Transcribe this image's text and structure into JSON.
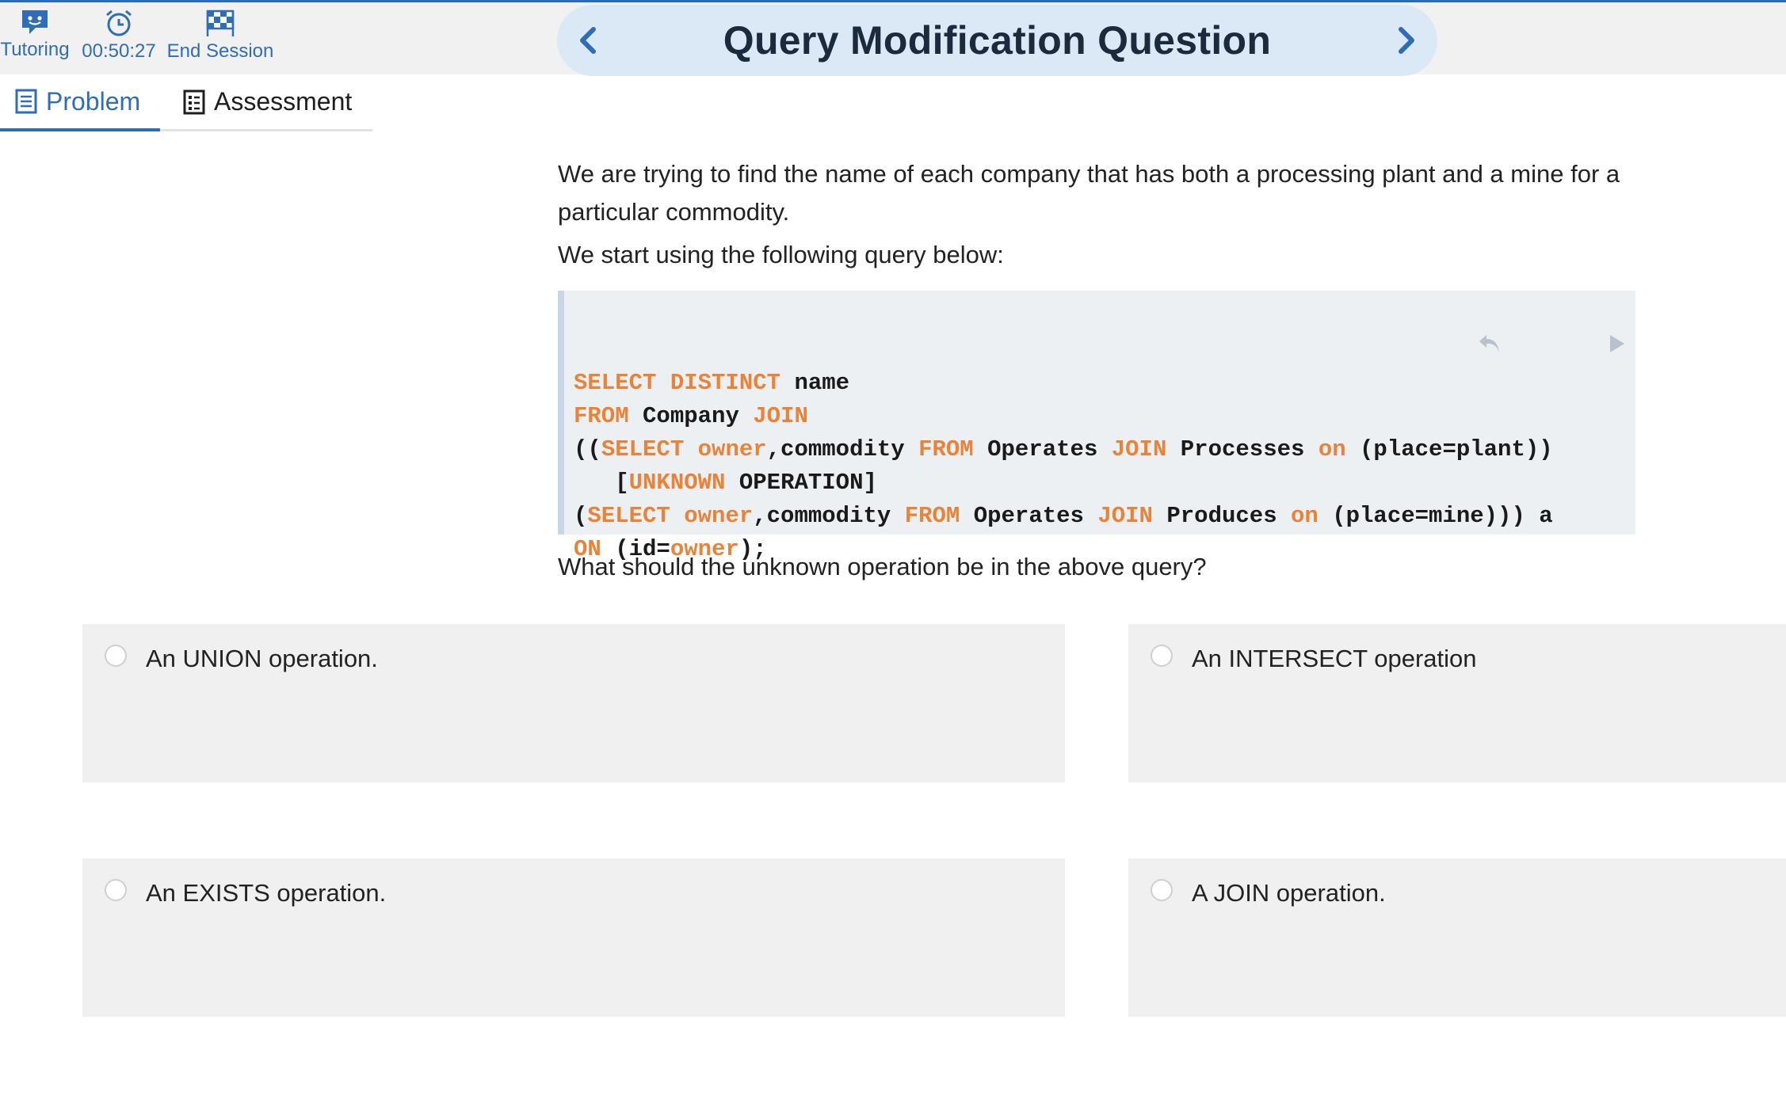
{
  "toolbar": {
    "tutoring_label": "Tutoring",
    "timer": "00:50:27",
    "end_session_label": "End Session",
    "accent_color": "#2f6db5"
  },
  "header": {
    "title": "Query Modification Question",
    "prev_icon": "chevron-left-icon",
    "next_icon": "chevron-right-icon"
  },
  "tabs": [
    {
      "label": "Problem",
      "icon": "document-icon",
      "active": true
    },
    {
      "label": "Assessment",
      "icon": "list-icon",
      "active": false
    }
  ],
  "problem": {
    "intro": "We are trying to find the name of each company that has both a processing plant and a mine for a particular commodity.",
    "lead": "We start using the following query below:",
    "question": "What should the unknown operation be in the above query?"
  },
  "code": {
    "keyword_color": "#e8833a",
    "lines": [
      [
        {
          "t": "SELECT DISTINCT",
          "k": true
        },
        {
          "t": " name",
          "k": false
        }
      ],
      [
        {
          "t": "FROM",
          "k": true
        },
        {
          "t": " Company ",
          "k": false
        },
        {
          "t": "JOIN",
          "k": true
        }
      ],
      [
        {
          "t": "((",
          "k": false
        },
        {
          "t": "SELECT owner",
          "k": true
        },
        {
          "t": ",commodity ",
          "k": false
        },
        {
          "t": "FROM",
          "k": true
        },
        {
          "t": " Operates ",
          "k": false
        },
        {
          "t": "JOIN",
          "k": true
        },
        {
          "t": " Processes ",
          "k": false
        },
        {
          "t": "on",
          "k": true
        },
        {
          "t": " (place=plant))",
          "k": false
        }
      ],
      [
        {
          "t": "   [",
          "k": false
        },
        {
          "t": "UNKNOWN",
          "k": true
        },
        {
          "t": " OPERATION]",
          "k": false
        }
      ],
      [
        {
          "t": "(",
          "k": false
        },
        {
          "t": "SELECT owner",
          "k": true
        },
        {
          "t": ",commodity ",
          "k": false
        },
        {
          "t": "FROM",
          "k": true
        },
        {
          "t": " Operates ",
          "k": false
        },
        {
          "t": "JOIN",
          "k": true
        },
        {
          "t": " Produces ",
          "k": false
        },
        {
          "t": "on",
          "k": true
        },
        {
          "t": " (place=mine))) a",
          "k": false
        }
      ],
      [
        {
          "t": "ON",
          "k": true
        },
        {
          "t": " (id=",
          "k": false
        },
        {
          "t": "owner",
          "k": true
        },
        {
          "t": ");",
          "k": false
        }
      ]
    ],
    "tools": [
      "undo-icon",
      "play-icon"
    ]
  },
  "choices": [
    {
      "label": "An UNION operation.",
      "selected": false
    },
    {
      "label": "An INTERSECT operation",
      "selected": false
    },
    {
      "label": "An EXISTS operation.",
      "selected": false
    },
    {
      "label": "A JOIN operation.",
      "selected": false
    }
  ]
}
